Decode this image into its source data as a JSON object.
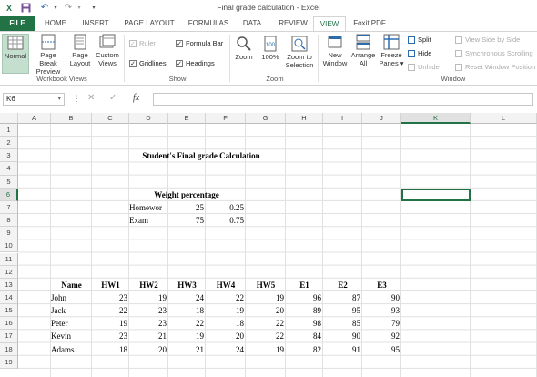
{
  "title": "Final grade calculation - Excel",
  "tabs": [
    "FILE",
    "HOME",
    "INSERT",
    "PAGE LAYOUT",
    "FORMULAS",
    "DATA",
    "REVIEW",
    "VIEW",
    "Foxit PDF"
  ],
  "workbook_views": {
    "normal": "Normal",
    "page_break": "Page Break Preview",
    "page_layout": "Page Layout",
    "custom": "Custom Views",
    "group": "Workbook Views"
  },
  "show": {
    "ruler": "Ruler",
    "formula_bar": "Formula Bar",
    "gridlines": "Gridlines",
    "headings": "Headings",
    "group": "Show"
  },
  "zoom": {
    "zoom": "Zoom",
    "hundred": "100%",
    "selection": "Zoom to Selection",
    "group": "Zoom"
  },
  "window": {
    "new_window": "New Window",
    "arrange_all": "Arrange All",
    "freeze": "Freeze Panes",
    "split": "Split",
    "hide": "Hide",
    "unhide": "Unhide",
    "side_by_side": "View Side by Side",
    "sync_scroll": "Synchronous Scrolling",
    "reset_pos": "Reset Window Position",
    "group": "Window"
  },
  "name_box": "K6",
  "fx": "fx",
  "columns": [
    "A",
    "B",
    "C",
    "D",
    "E",
    "F",
    "G",
    "H",
    "I",
    "J",
    "K",
    "L"
  ],
  "rows": [
    "1",
    "2",
    "3",
    "4",
    "5",
    "6",
    "7",
    "8",
    "9",
    "10",
    "11",
    "12",
    "13",
    "14",
    "15",
    "16",
    "17",
    "18",
    "19"
  ],
  "sheet": {
    "heading": "Student's Final grade Calculation",
    "weight_title": "Weight percentage",
    "weights": [
      {
        "label": "Homewor",
        "points": "25",
        "pct": "0.25"
      },
      {
        "label": "Exam",
        "points": "75",
        "pct": "0.75"
      }
    ],
    "table_headers": [
      "Name",
      "HW1",
      "HW2",
      "HW3",
      "HW4",
      "HW5",
      "E1",
      "E2",
      "E3"
    ],
    "students": [
      [
        "John",
        "23",
        "19",
        "24",
        "22",
        "19",
        "96",
        "87",
        "90"
      ],
      [
        "Jack",
        "22",
        "23",
        "18",
        "19",
        "20",
        "89",
        "95",
        "93"
      ],
      [
        "Peter",
        "19",
        "23",
        "22",
        "18",
        "22",
        "98",
        "85",
        "79"
      ],
      [
        "Kevin",
        "23",
        "21",
        "19",
        "20",
        "22",
        "84",
        "90",
        "92"
      ],
      [
        "Adams",
        "18",
        "20",
        "21",
        "24",
        "19",
        "82",
        "91",
        "95"
      ]
    ]
  }
}
